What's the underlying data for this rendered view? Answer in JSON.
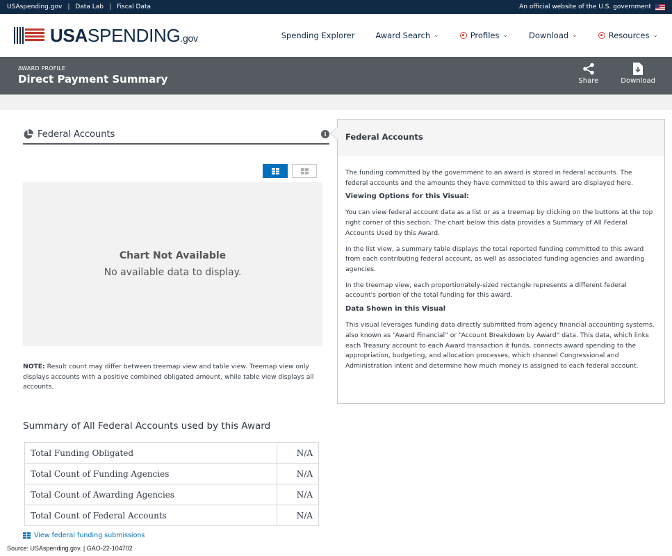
{
  "banner": {
    "links": [
      "USAspending.gov",
      "Data Lab",
      "Fiscal Data"
    ],
    "official": "An official website of the U.S. government"
  },
  "header": {
    "logo_bold": "USA",
    "logo_rest": "SPENDING",
    "logo_suffix": ".gov",
    "nav": [
      {
        "label": "Spending Explorer"
      },
      {
        "label": "Award Search"
      },
      {
        "label": "Profiles"
      },
      {
        "label": "Download"
      },
      {
        "label": "Resources"
      }
    ]
  },
  "title_bar": {
    "eyebrow": "AWARD PROFILE",
    "title": "Direct Payment Summary",
    "share_label": "Share",
    "download_label": "Download"
  },
  "federal_accounts": {
    "title": "Federal Accounts",
    "chart_na_title": "Chart Not Available",
    "chart_na_sub": "No available data to display.",
    "note_label": "NOTE:",
    "note_text": " Result count may differ between treemap view and table view. Treemap view only displays accounts with a positive combined obligated amount, while table view displays all accounts."
  },
  "summary": {
    "title": "Summary of All Federal Accounts used by this Award",
    "rows": [
      {
        "label": "Total Funding Obligated",
        "value": "N/A"
      },
      {
        "label": "Total Count of Funding Agencies",
        "value": "N/A"
      },
      {
        "label": "Total Count of Awarding Agencies",
        "value": "N/A"
      },
      {
        "label": "Total Count of Federal Accounts",
        "value": "N/A"
      }
    ]
  },
  "submissions_link": "View federal funding submissions",
  "source": "Source: USAspending.gov.  |  GAO-22-104702",
  "panel": {
    "title": "Federal Accounts",
    "p1": "The funding committed by the government to an award is stored in federal accounts. The federal accounts and the amounts they have committed to this award are displayed here.",
    "h1": "Viewing Options for this Visual:",
    "p2": "You can view federal account data as a list or as a treemap by clicking on the buttons at the top right corner of this section. The chart below this data provides a Summary of All Federal Accounts Used by this Award.",
    "p3": "In the list view, a summary table displays the total reported funding committed to this award from each contributing federal account, as well as associated funding agencies and awarding agencies.",
    "p4": "In the treemap view, each proportionately-sized rectangle represents a different federal account's portion of the total funding for this award.",
    "h2": "Data Shown in this Visual",
    "p5": "This visual leverages funding data directly submitted from agency financial accounting systems, also known as “Award Financial” or “Account Breakdown by Award” data. This data, which links each Treasury account to each Award transaction it funds, connects award spending to the appropriation, budgeting, and allocation processes, which channel Congressional and Administration intent and determine how much money is assigned to each federal account."
  }
}
